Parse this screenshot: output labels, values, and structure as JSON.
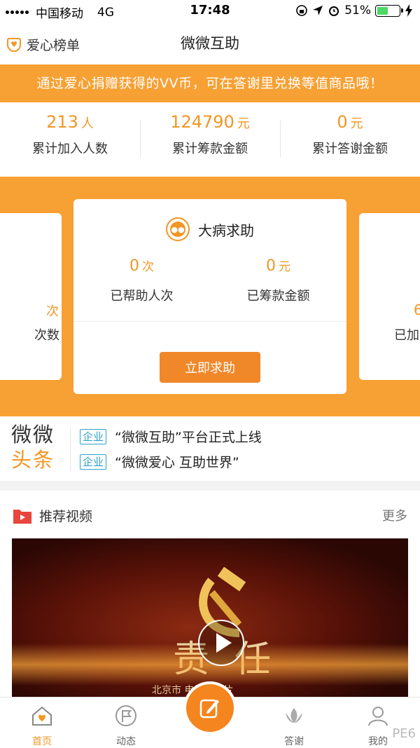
{
  "status_bar": {
    "carrier": "中国移动",
    "network": "4G",
    "time": "17:48",
    "battery": "51%",
    "battery_level": 0.51
  },
  "nav": {
    "left_label": "爱心榜单",
    "title": "微微互助"
  },
  "notice": "通过爱心捐赠获得的VV币，可在答谢里兑换等值商品哦！",
  "stats": [
    {
      "value": "213",
      "unit": "人",
      "label": "累计加入人数"
    },
    {
      "value": "124790",
      "unit": "元",
      "label": "累计筹款金额"
    },
    {
      "value": "0",
      "unit": "元",
      "label": "累计答谢金额"
    }
  ],
  "card": {
    "title": "大病求助",
    "stats": [
      {
        "value": "0",
        "unit": "次",
        "label": "已帮助人次"
      },
      {
        "value": "0",
        "unit": "元",
        "label": "已筹款金额"
      }
    ],
    "button": "立即求助"
  },
  "peek_left": {
    "value": "次",
    "label": "次数"
  },
  "peek_right": {
    "value": "6",
    "label": "已加"
  },
  "headlines": {
    "logo_line1": "微微",
    "logo_line2": "头条",
    "items": [
      {
        "tag": "企业",
        "text": "“微微互助”平台正式上线"
      },
      {
        "tag": "企业",
        "text": "“微微爱心  互助世界”"
      }
    ]
  },
  "videos": {
    "title": "推荐视频",
    "more": "更多",
    "thumb_title": "责任",
    "thumb_caption": "北京市  电视宣传片"
  },
  "tabs": [
    {
      "label": "首页"
    },
    {
      "label": "动态"
    },
    {
      "label": "答谢"
    },
    {
      "label": "我的"
    }
  ],
  "watermark": "PE6",
  "colors": {
    "accent": "#f7a033",
    "button": "#f0882a",
    "tag": "#2aa3c9"
  }
}
